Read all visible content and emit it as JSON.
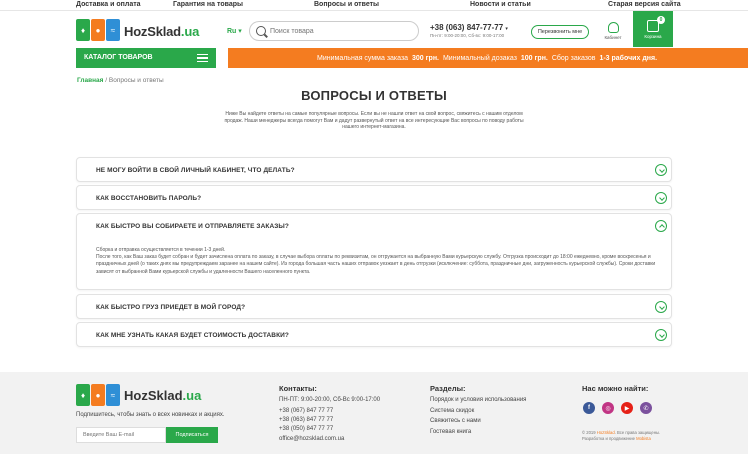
{
  "colors": {
    "accent": "#2aa84a",
    "promo": "#f47c20"
  },
  "topnav": [
    "Доставка и оплата",
    "Гарантия на товары",
    "Вопросы и ответы",
    "Новости и статьи",
    "Старая версия сайта"
  ],
  "header": {
    "logo_text": "HozSklad",
    "logo_suffix": ".ua",
    "lang": "Ru",
    "search_placeholder": "Поиск товара",
    "phone": "+38 (063) 847-77-77",
    "hours": "Пн-пт: 9:00-20:00, Сб-вс: 9:00-17:00",
    "callback": "Перезвонить мне",
    "cabinet": "Кабинет",
    "cart_label": "Корзина",
    "cart_count": "0"
  },
  "catalog_label": "КАТАЛОГ ТОВАРОВ",
  "promo": {
    "p1": "Минимальная сумма заказа",
    "sum": "300 грн.",
    "p2": "Минимальный дозаказ",
    "dozakaz": "100 грн.",
    "p3": "Сбор заказов",
    "days": "1-3 рабочих дня."
  },
  "breadcrumb": {
    "home": "Главная",
    "sep": "/",
    "current": "Вопросы и ответы"
  },
  "page_title": "ВОПРОСЫ И ОТВЕТЫ",
  "intro": "Ниже Вы найдете ответы на самые популярные вопросы. Если вы не нашли ответ на свой вопрос, свяжитесь с нашим отделом продаж. Наши менеджеры всегда помогут Вам и дадут развернутый ответ на все интересующие Вас вопросы по поводу работы нашего интернет-магазина.",
  "faq": [
    {
      "q": "НЕ МОГУ ВОЙТИ В СВОЙ ЛИЧНЫЙ КАБИНЕТ, ЧТО ДЕЛАТЬ?",
      "open": false
    },
    {
      "q": "КАК ВОССТАНОВИТЬ ПАРОЛЬ?",
      "open": false
    },
    {
      "q": "КАК БЫСТРО ВЫ СОБИРАЕТЕ И ОТПРАВЛЯЕТЕ ЗАКАЗЫ?",
      "open": true
    },
    {
      "q": "КАК БЫСТРО ГРУЗ ПРИЕДЕТ В МОЙ ГОРОД?",
      "open": false
    },
    {
      "q": "КАК МНЕ УЗНАТЬ КАКАЯ БУДЕТ СТОИМОСТЬ ДОСТАВКИ?",
      "open": false
    }
  ],
  "answer": {
    "line1": "Сборка и отправка осуществляется в течении 1-3 дней.",
    "line2": "После того, как Ваш заказ будет собран и будет зачислена оплата по заказу, в случае выбора оплаты по реквизитам, он отгружается на выбранную Вами курьерскую службу. Отгрузка происходит до 18:00 ежедневно, кроме воскресенья и праздничных дней (о таких днях мы предупреждаем заранее на нашем сайте). Из города большая часть наших отправок уезжает в день отгрузки (исключение: суббота, праздничные дни, загруженность курьерской службы). Сроки доставки зависят от выбранной Вами курьерской службы и удаленности Вашего населенного пункта."
  },
  "footer": {
    "subscribe_text": "Подпишитесь, чтобы знать о всех новинках и акциях.",
    "email_placeholder": "Введите Ваш E-mail",
    "subscribe_btn": "Подписаться",
    "contacts_title": "Контакты:",
    "contacts": [
      "ПН-ПТ: 9:00-20:00, Сб-Вс 9:00-17:00",
      "+38 (067) 847 77 77",
      "+38 (063) 847 77 77",
      "+38 (050) 847 77 77",
      "office@hozsklad.com.ua"
    ],
    "sections_title": "Разделы:",
    "sections": [
      "Порядок и условия использования",
      "Система скидок",
      "Свяжитесь с нами",
      "Гостевая книга"
    ],
    "social_title": "Нас можно найти:",
    "social_icons": [
      "facebook-icon",
      "instagram-icon",
      "youtube-icon",
      "viber-icon"
    ],
    "copyright_pre": "© 2019",
    "copyright_brand": "HozSklad",
    "copyright_post": ". Все права защищены.",
    "dev_pre": "Разработка и продвижение",
    "dev_name": "Mobista"
  }
}
